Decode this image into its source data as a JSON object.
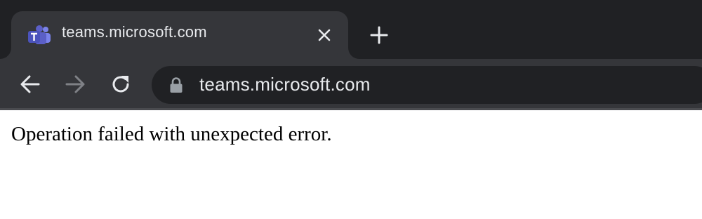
{
  "tab": {
    "title": "teams.microsoft.com",
    "favicon": "microsoft-teams-icon",
    "close_icon": "close-icon"
  },
  "new_tab_icon": "plus-icon",
  "toolbar": {
    "back_icon": "arrow-left-icon",
    "forward_icon": "arrow-right-icon",
    "reload_icon": "reload-icon",
    "url": "teams.microsoft.com",
    "lock_icon": "lock-icon"
  },
  "page": {
    "message": "Operation failed with unexpected error."
  },
  "colors": {
    "tab_strip": "#202124",
    "active_tab": "#35363a",
    "omnibox": "#202124",
    "text_light": "#e8eaed",
    "teams_brand": "#5b5fc7"
  }
}
